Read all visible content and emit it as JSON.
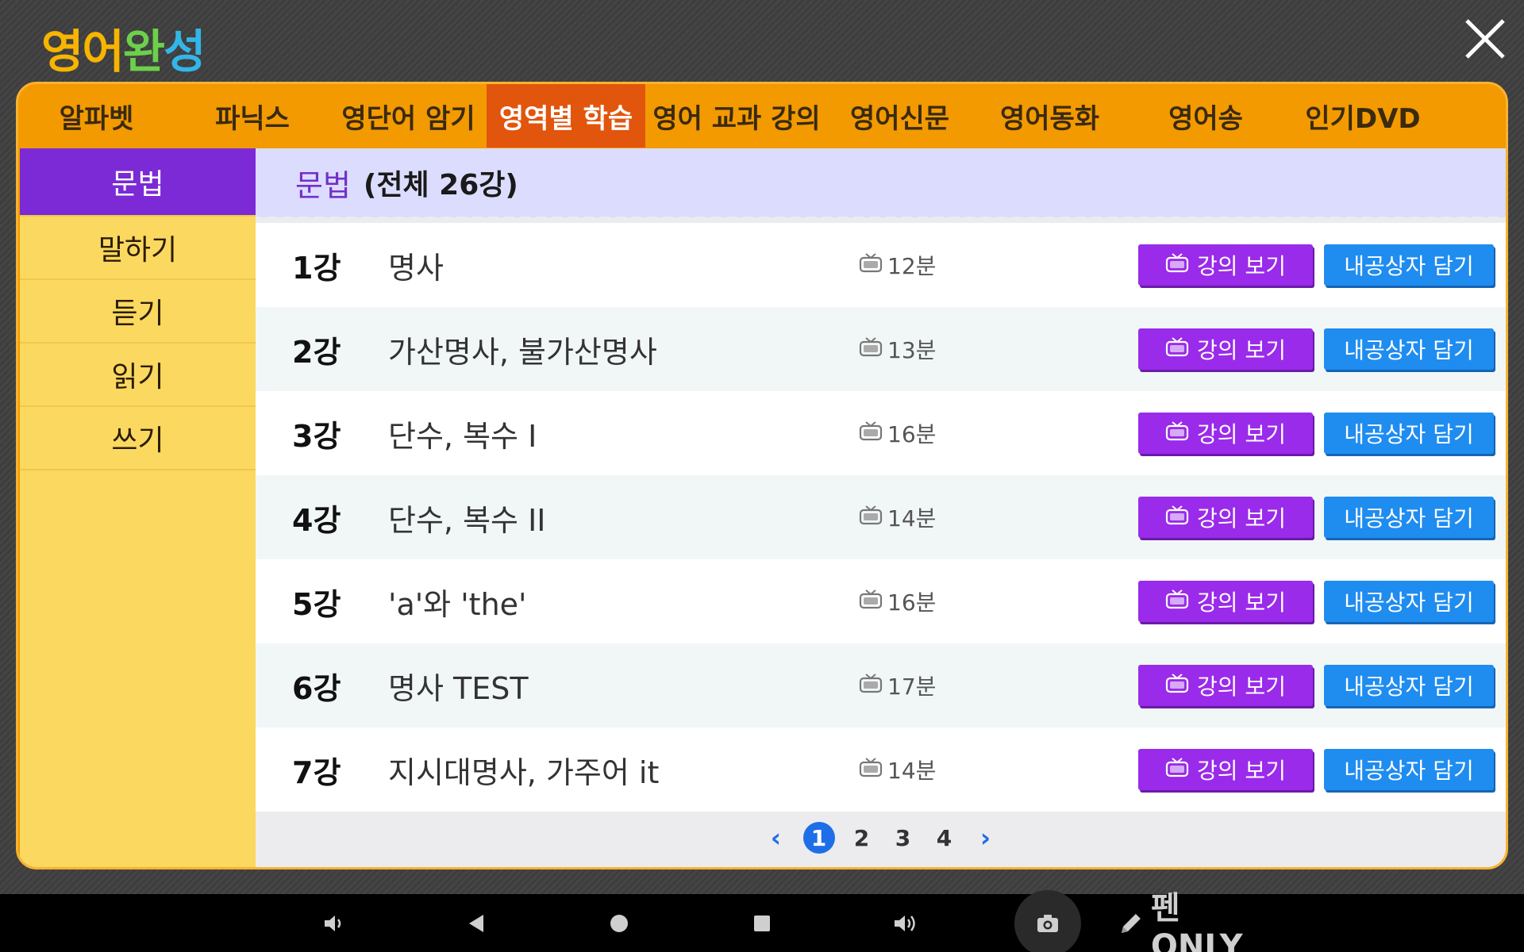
{
  "app": {
    "logo_chars": [
      {
        "char": "영",
        "color": "#f7b400"
      },
      {
        "char": "어",
        "color": "#f7b400"
      },
      {
        "char": "완",
        "color": "#6cd04b"
      },
      {
        "char": "성",
        "color": "#32b6e8"
      }
    ]
  },
  "tabs": [
    {
      "label": "알파벳",
      "active": false,
      "width": 197
    },
    {
      "label": "파닉스",
      "active": false,
      "width": 196
    },
    {
      "label": "영단어 암기",
      "active": false,
      "width": 197
    },
    {
      "label": "영역별 학습",
      "active": true,
      "width": 200
    },
    {
      "label": "영어 교과 강의",
      "active": false,
      "width": 230
    },
    {
      "label": "영어신문",
      "active": false,
      "width": 181
    },
    {
      "label": "영어동화",
      "active": false,
      "width": 197
    },
    {
      "label": "영어송",
      "active": false,
      "width": 196
    },
    {
      "label": "인기DVD",
      "active": false,
      "width": 200
    }
  ],
  "sidebar": {
    "items": [
      {
        "label": "문법",
        "active": true
      },
      {
        "label": "말하기",
        "active": false
      },
      {
        "label": "듣기",
        "active": false
      },
      {
        "label": "읽기",
        "active": false
      },
      {
        "label": "쓰기",
        "active": false
      }
    ]
  },
  "content": {
    "title": "문법",
    "total": "(전체 26강)",
    "watch_label": "강의 보기",
    "save_label": "내공상자 담기",
    "lectures": [
      {
        "num": "1강",
        "title": "명사",
        "duration": "12분"
      },
      {
        "num": "2강",
        "title": "가산명사, 불가산명사",
        "duration": "13분"
      },
      {
        "num": "3강",
        "title": "단수, 복수 I",
        "duration": "16분"
      },
      {
        "num": "4강",
        "title": "단수, 복수 II",
        "duration": "14분"
      },
      {
        "num": "5강",
        "title": "'a'와 'the'",
        "duration": "16분"
      },
      {
        "num": "6강",
        "title": "명사 TEST",
        "duration": "17분"
      },
      {
        "num": "7강",
        "title": "지시대명사, 가주어 it",
        "duration": "14분"
      }
    ]
  },
  "pager": {
    "prev": "‹",
    "next": "›",
    "pages": [
      "1",
      "2",
      "3",
      "4"
    ],
    "current": "1"
  },
  "navbar": {
    "pen_label": "펜 ONLY"
  },
  "colors": {
    "accent_orange": "#f39a00",
    "active_tab": "#e2550c",
    "sidebar_active": "#7b2ad6",
    "watch_button": "#9a2bea",
    "save_button": "#1f8cf0"
  }
}
